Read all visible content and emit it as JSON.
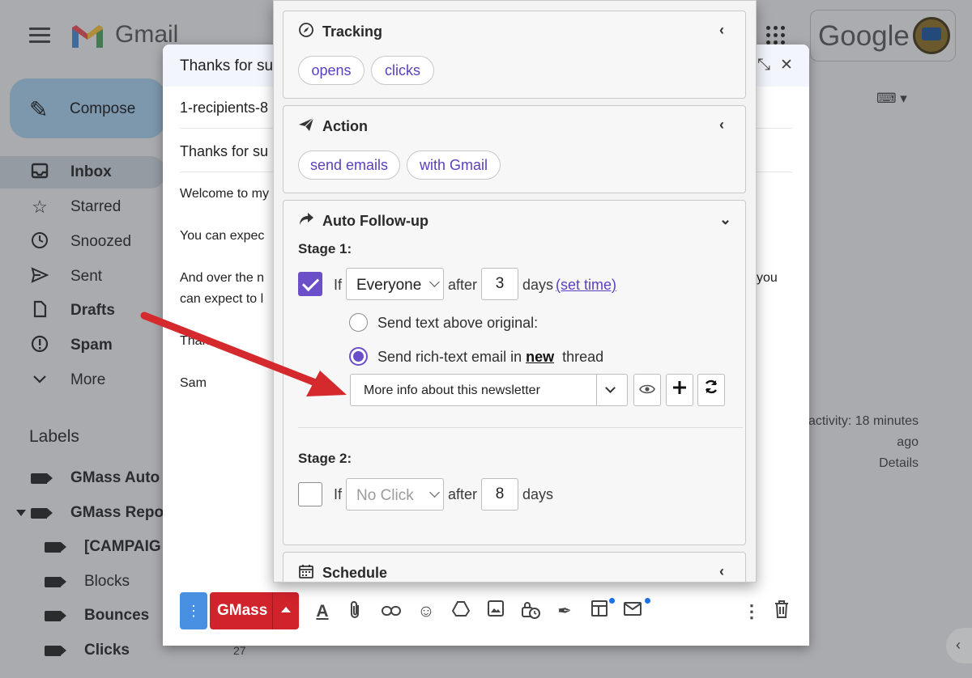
{
  "gmail": {
    "logo_text": "Gmail",
    "compose_label": "Compose",
    "nav": [
      {
        "label": "Inbox",
        "icon": "inbox-icon",
        "bold": true
      },
      {
        "label": "Starred",
        "icon": "star-icon",
        "bold": false
      },
      {
        "label": "Snoozed",
        "icon": "clock-icon",
        "bold": false
      },
      {
        "label": "Sent",
        "icon": "send-icon",
        "bold": false
      },
      {
        "label": "Drafts",
        "icon": "file-icon",
        "bold": true
      },
      {
        "label": "Spam",
        "icon": "alert-icon",
        "bold": true
      },
      {
        "label": "More",
        "icon": "chevron-down-icon",
        "bold": false
      }
    ],
    "labels_heading": "Labels",
    "labels": [
      {
        "label": "GMass Auto"
      },
      {
        "label": "GMass Repor"
      },
      {
        "label": "[CAMPAIG"
      },
      {
        "label": "Blocks"
      },
      {
        "label": "Bounces"
      },
      {
        "label": "Clicks"
      }
    ],
    "clicks_count": "27",
    "google_word": "Google",
    "activity_line1": "activity: 18 minutes",
    "activity_line2": "ago",
    "details_link": "Details"
  },
  "compose": {
    "title": "Thanks for su",
    "recipients": "1-recipients-8",
    "subject": "Thanks for su",
    "body_lines": [
      "Welcome to my",
      "You can expec",
      "And over the n",
      "can expect to l",
      "Than",
      "Sam"
    ],
    "body_trailing": "you",
    "gmass_label": "GMass"
  },
  "panel": {
    "tracking": {
      "title": "Tracking",
      "pills": [
        "opens",
        "clicks"
      ]
    },
    "action": {
      "title": "Action",
      "pills": [
        "send emails",
        "with Gmail"
      ]
    },
    "followup": {
      "title": "Auto Follow-up",
      "stage1": {
        "label": "Stage 1:",
        "checked": true,
        "if_word": "If",
        "condition": "Everyone",
        "after_word": "after",
        "days_value": "3",
        "days_word": "days",
        "set_time_link": "(set time)",
        "radio1_label": "Send text above original:",
        "radio2_prefix": "Send rich-text email in",
        "radio2_link": "new",
        "radio2_suffix": "thread",
        "template": "More info about this newsletter"
      },
      "stage2": {
        "label": "Stage 2:",
        "checked": false,
        "if_word": "If",
        "condition": "No Click",
        "after_word": "after",
        "days_value": "8",
        "days_word": "days"
      }
    },
    "schedule": {
      "title": "Schedule"
    }
  },
  "colors": {
    "accent_purple": "#6b4fc8",
    "gmass_red": "#d0232c",
    "arrow_red": "#d42a2e"
  }
}
